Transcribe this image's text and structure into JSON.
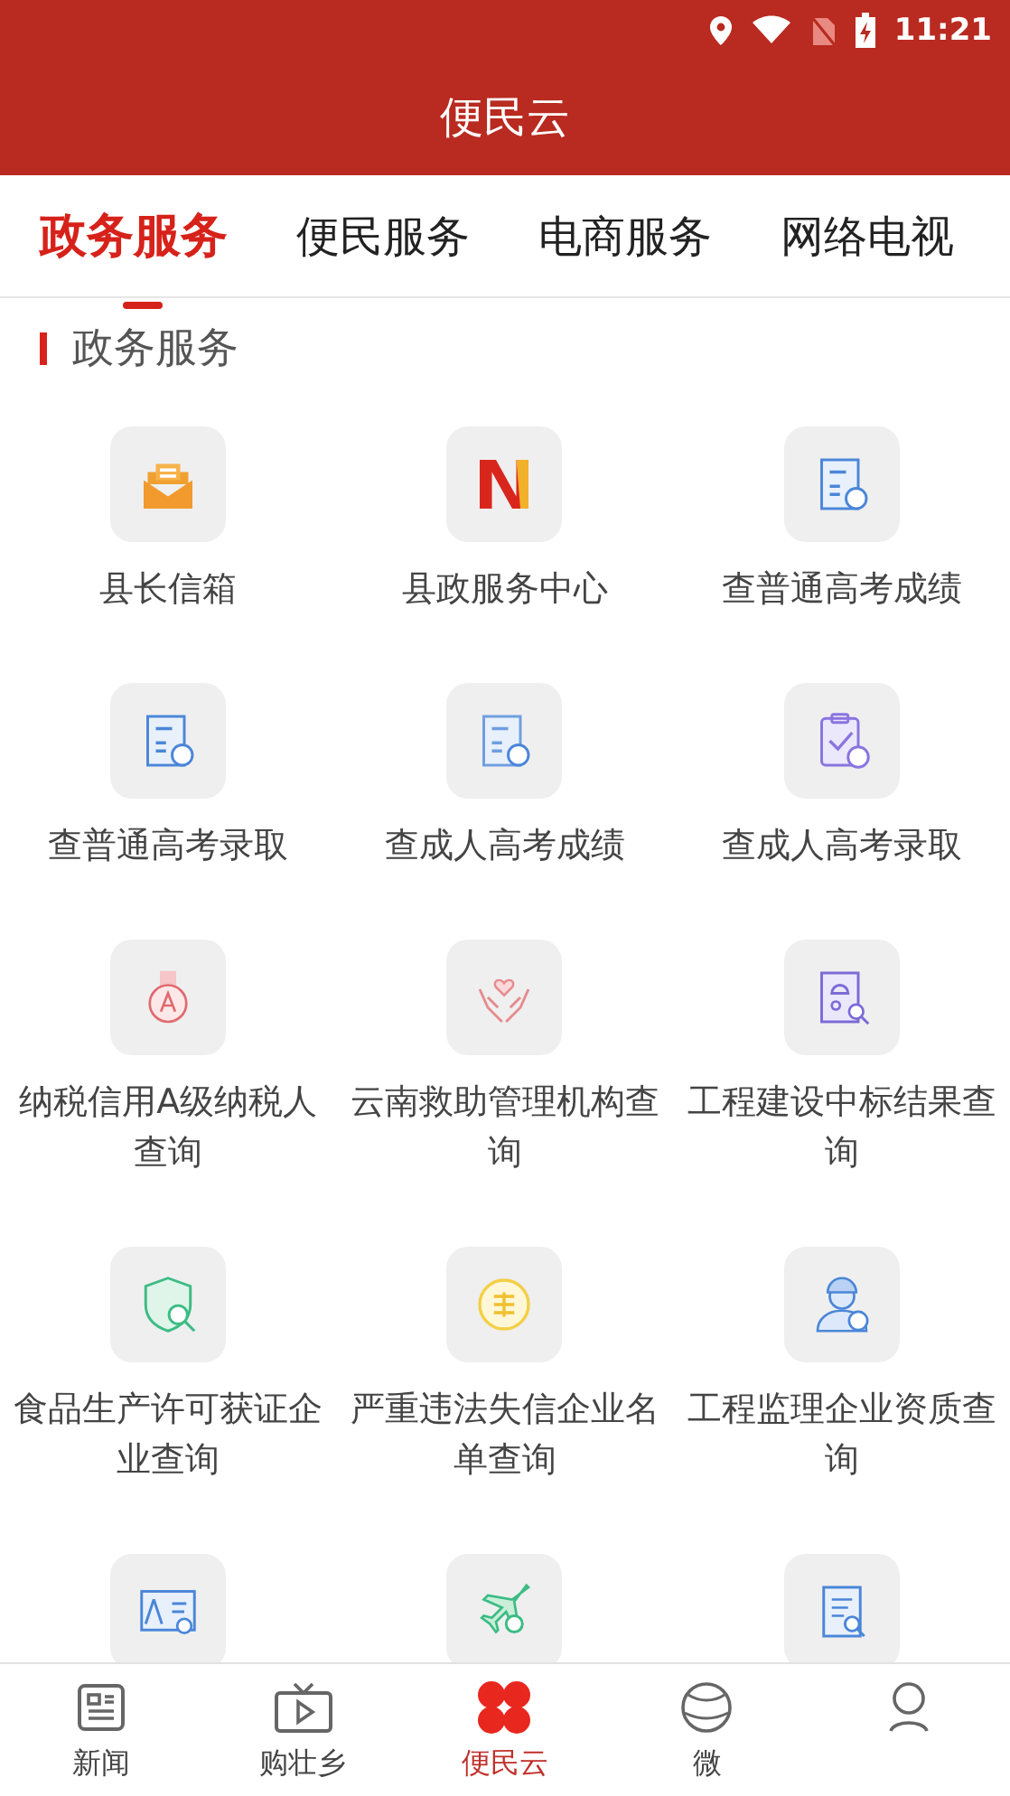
{
  "status_bar": {
    "time": "11:21"
  },
  "app_bar": {
    "title": "便民云"
  },
  "tabs": [
    {
      "label": "政务服务",
      "selected": true
    },
    {
      "label": "便民服务",
      "selected": false
    },
    {
      "label": "电商服务",
      "selected": false
    },
    {
      "label": "网络电视",
      "selected": false
    }
  ],
  "section": {
    "title": "政务服务"
  },
  "services": [
    {
      "label": "县长信箱"
    },
    {
      "label": "县政服务中心"
    },
    {
      "label": "查普通高考成绩"
    },
    {
      "label": "查普通高考录取"
    },
    {
      "label": "查成人高考成绩"
    },
    {
      "label": "查成人高考录取"
    },
    {
      "label": "纳税信用A级纳税人查询"
    },
    {
      "label": "云南救助管理机构查询"
    },
    {
      "label": "工程建设中标结果查询"
    },
    {
      "label": "食品生产许可获证企业查询"
    },
    {
      "label": "严重违法失信企业名单查询"
    },
    {
      "label": "工程监理企业资质查询"
    }
  ],
  "bottom_nav": [
    {
      "label": "新闻",
      "selected": false
    },
    {
      "label": "购壮乡",
      "selected": false
    },
    {
      "label": "便民云",
      "selected": true
    },
    {
      "label": "微",
      "selected": false
    },
    {
      "selected": false
    }
  ]
}
